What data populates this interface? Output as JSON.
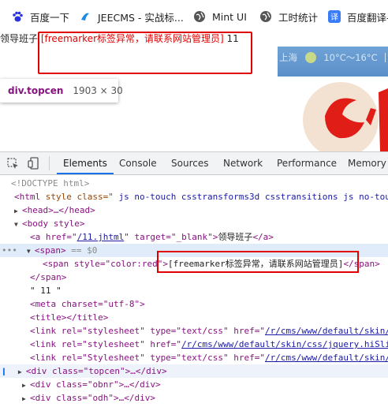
{
  "bookmarks": [
    {
      "label": "百度一下",
      "icon": "baidu-paw-icon"
    },
    {
      "label": "JEECMS - 实战标...",
      "icon": "jeecms-logo-icon"
    },
    {
      "label": "Mint UI",
      "icon": "globe-icon"
    },
    {
      "label": "工时统计",
      "icon": "globe-icon"
    },
    {
      "label": "百度翻译-",
      "icon": "baidu-translate-icon"
    }
  ],
  "page": {
    "link_text": "领导班子",
    "error_text": "[freemarker标签异常，请联系网站管理员]",
    "suffix": " 11",
    "weather": {
      "city": "上海",
      "temp": "10°C～16°C"
    }
  },
  "tooltip": {
    "selector": "div.topcen",
    "size": "1903 × 30"
  },
  "devtools": {
    "tabs": [
      "Elements",
      "Console",
      "Sources",
      "Network",
      "Performance",
      "Memory"
    ],
    "active_tab": "Elements",
    "lines": {
      "l1": "<!DOCTYPE html>",
      "l2_tag": "<html",
      "l2_attr": " style class=\"",
      "l2_val": " js no-touch csstransforms3d csstransitions js no-touc",
      "l3": "<head>…</head>",
      "l4": "<body style>",
      "l5_a": "<a href=\"",
      "l5_href": "/11.jhtml",
      "l5_b": "\" target=\"_blank\">",
      "l5_text": "领导班子",
      "l5_c": "</a>",
      "l6": "<span>",
      "l6_eq": " == $0",
      "l7_a": "<span style=\"color:red\">",
      "l7_text": "[freemarker标签异常，请联系网站管理员]",
      "l7_c": "</span>",
      "l8": "</span>",
      "l9": "\" 11 \"",
      "l10": "<meta charset=\"utf-8\">",
      "l11": "<title></title>",
      "l12_a": "<link rel=\"stylesheet\" type=\"text/css\" href=\"",
      "l12_href": "/r/cms/www/default/skin/",
      "l13_a": "<link rel=\"stylesheet\" href=\"",
      "l13_href": "/r/cms/www/default/skin/css/jquery.hiSli",
      "l14_a": "<link rel=\"Stylesheet\" type=\"text/css\" href=\"",
      "l14_href": "/r/cms/www/default/skin/",
      "l15": "<div class=\"topcen\">…</div>",
      "l16": "<div class=\"obnr\">…</div>",
      "l17": "<div class=\"odh\">…</div>"
    }
  },
  "colors": {
    "accent": "#1a73e8",
    "error": "#e00000",
    "selection": "#e1ecfb"
  }
}
